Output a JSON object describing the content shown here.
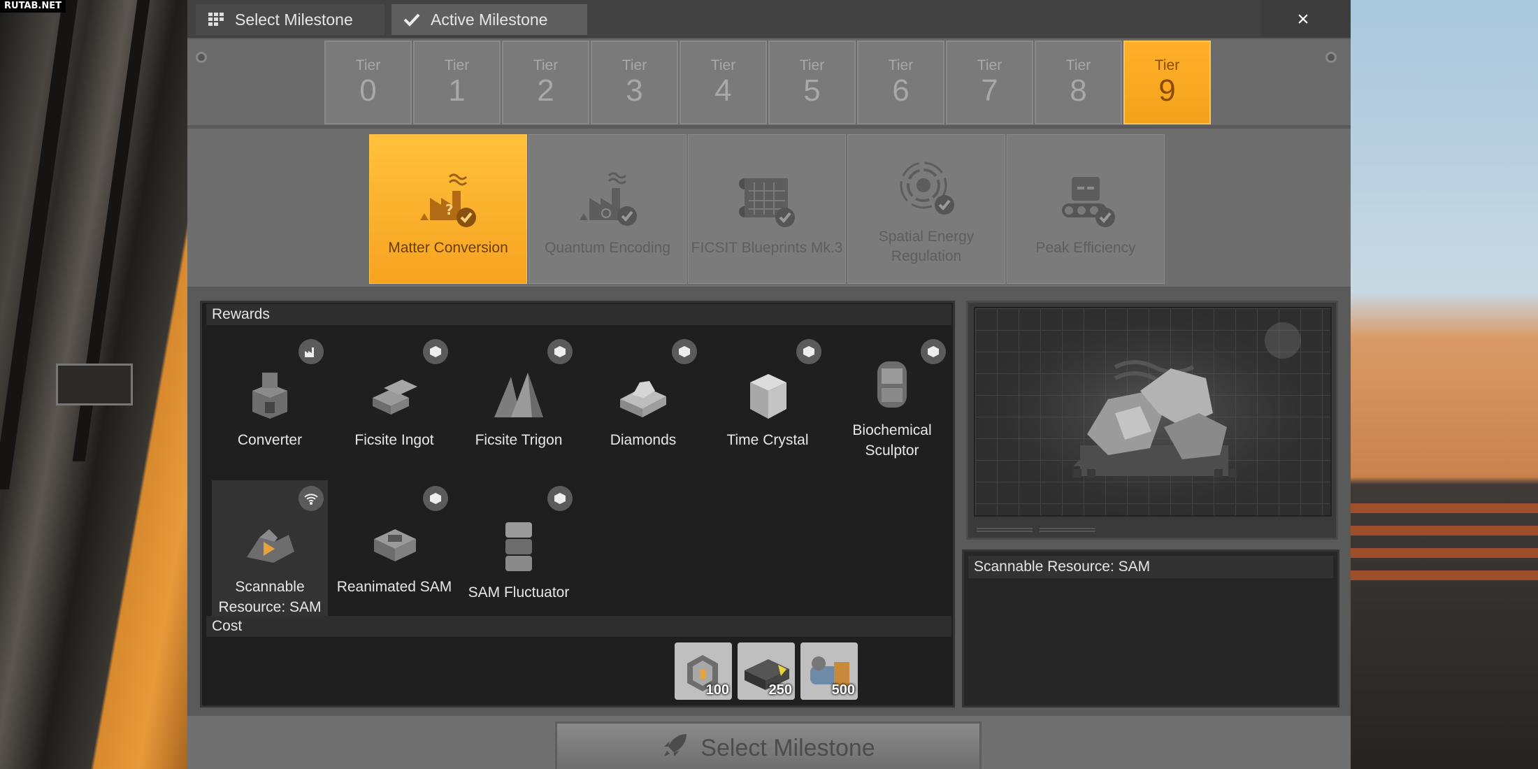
{
  "watermark": "RUTAB.NET",
  "header": {
    "tabs": [
      {
        "label": "Select Milestone",
        "icon": "grid-icon"
      },
      {
        "label": "Active Milestone",
        "icon": "checkmark-icon"
      }
    ],
    "close_label": "×"
  },
  "tiers": [
    {
      "label": "Tier",
      "number": "0"
    },
    {
      "label": "Tier",
      "number": "1"
    },
    {
      "label": "Tier",
      "number": "2"
    },
    {
      "label": "Tier",
      "number": "3"
    },
    {
      "label": "Tier",
      "number": "4"
    },
    {
      "label": "Tier",
      "number": "5"
    },
    {
      "label": "Tier",
      "number": "6"
    },
    {
      "label": "Tier",
      "number": "7"
    },
    {
      "label": "Tier",
      "number": "8"
    },
    {
      "label": "Tier",
      "number": "9"
    }
  ],
  "selected_tier": "9",
  "milestones": [
    {
      "label": "Matter Conversion",
      "icon": "factory-question-icon"
    },
    {
      "label": "Quantum Encoding",
      "icon": "factory-quantum-icon"
    },
    {
      "label": "FICSIT Blueprints Mk.3",
      "icon": "blueprint-icon"
    },
    {
      "label": "Spatial Energy Regulation",
      "icon": "energy-rings-icon"
    },
    {
      "label": "Peak Efficiency",
      "icon": "conveyor-machine-icon"
    }
  ],
  "selected_milestone": "Matter Conversion",
  "rewards": {
    "header": "Rewards",
    "items": [
      {
        "label": "Converter",
        "badge": "building-icon"
      },
      {
        "label": "Ficsite Ingot",
        "badge": "item-icon"
      },
      {
        "label": "Ficsite Trigon",
        "badge": "item-icon"
      },
      {
        "label": "Diamonds",
        "badge": "item-icon"
      },
      {
        "label": "Time Crystal",
        "badge": "item-icon"
      },
      {
        "label": "Biochemical Sculptor",
        "badge": "item-icon"
      },
      {
        "label": "Scannable Resource: SAM",
        "badge": "scan-signal-icon"
      },
      {
        "label": "Reanimated SAM",
        "badge": "item-icon"
      },
      {
        "label": "SAM Fluctuator",
        "badge": "item-icon"
      }
    ]
  },
  "cost": {
    "header": "Cost",
    "items": [
      {
        "quantity": "100",
        "icon": "frame-icon"
      },
      {
        "quantity": "250",
        "icon": "battery-icon"
      },
      {
        "quantity": "500",
        "icon": "motor-icon"
      }
    ]
  },
  "details": {
    "title": "Scannable Resource: SAM"
  },
  "actions": {
    "select_label": "Select Milestone",
    "select_icon": "rocket-icon"
  },
  "colors": {
    "selected_orange": "#f7a320",
    "panel_dark": "#1f1f1f",
    "window_gray": "#6e6e6e"
  }
}
